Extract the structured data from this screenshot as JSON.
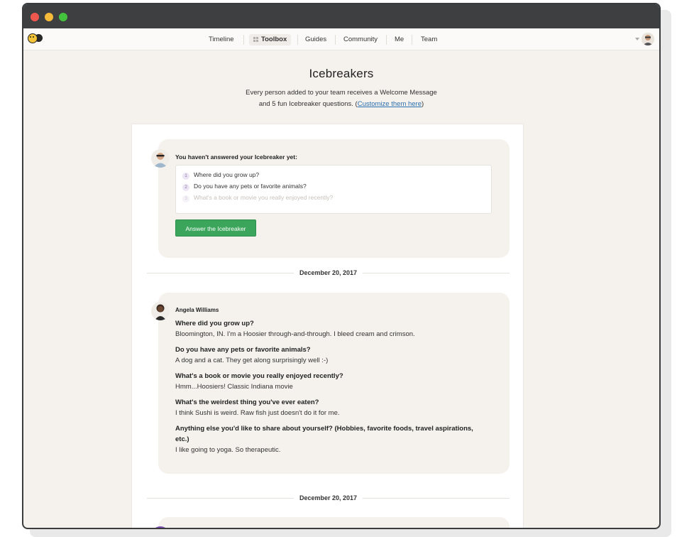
{
  "nav": {
    "items": [
      {
        "label": "Timeline"
      },
      {
        "label": "Toolbox"
      },
      {
        "label": "Guides"
      },
      {
        "label": "Community"
      },
      {
        "label": "Me"
      },
      {
        "label": "Team"
      }
    ],
    "active": "Toolbox"
  },
  "header": {
    "title": "Icebreakers",
    "subtitle_line1": "Every person added to your team receives a Welcome Message",
    "subtitle_line2_prefix": "and 5 fun Icebreaker questions. (",
    "customize_link": "Customize them here",
    "subtitle_line2_suffix": ")"
  },
  "prompt": {
    "title": "You haven't answered your Icebreaker yet:",
    "questions": [
      {
        "num": "1",
        "text": "Where did you grow up?"
      },
      {
        "num": "2",
        "text": "Do you have any pets or favorite animals?"
      },
      {
        "num": "3",
        "text": "What's a book or movie you really enjoyed recently?"
      }
    ],
    "button_label": "Answer the Icebreaker"
  },
  "entries": [
    {
      "date": "December 20, 2017",
      "name": "Angela Williams",
      "qa": [
        {
          "q": "Where did you grow up?",
          "a": "Bloomington, IN. I'm a Hoosier through-and-through. I bleed cream and crimson."
        },
        {
          "q": "Do you have any pets or favorite animals?",
          "a": "A dog and a cat. They get along surprisingly well :-)"
        },
        {
          "q": "What's a book or movie you really enjoyed recently?",
          "a": "Hmm...Hoosiers! Classic Indiana movie"
        },
        {
          "q": "What's the weirdest thing you've ever eaten?",
          "a": "I think Sushi is weird. Raw fish just doesn't do it for me."
        },
        {
          "q": "Anything else you'd like to share about yourself? (Hobbies, favorite foods, travel aspirations, etc.)",
          "a": "I like going to yoga. So therapeutic."
        }
      ]
    },
    {
      "date": "December 20, 2017"
    }
  ],
  "colors": {
    "accent_green": "#3aa55b",
    "link_blue": "#2c6fb0",
    "page_bg": "#f5f1ed",
    "titlebar": "#3d3f41"
  },
  "icons": [
    "logo-icon",
    "grid-icon",
    "chevron-down-icon",
    "user-avatar-icon"
  ]
}
